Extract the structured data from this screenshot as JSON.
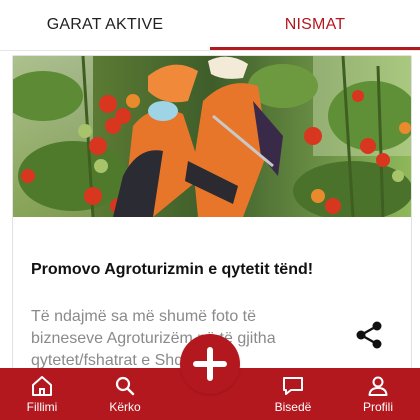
{
  "tabs": [
    {
      "label": "GARAT AKTIVE",
      "active": false
    },
    {
      "label": "NISMAT",
      "active": true
    }
  ],
  "card": {
    "image_icon": "greenhouse-tomato-workers-photo",
    "title": "Promovo Agroturizmin e qytetit tënd!",
    "body_lines": [
      "Të ndajmë sa më shumë foto të",
      "bizneseve Agroturizëm në të gjitha",
      "qytetet/fshatrat e Shq"
    ],
    "share_icon": "share-icon"
  },
  "bottom_nav": {
    "items": [
      {
        "label": "Fillimi",
        "icon": "home-icon"
      },
      {
        "label": "Kërko",
        "icon": "search-icon"
      },
      {
        "label": "Bisedë",
        "icon": "chat-icon"
      },
      {
        "label": "Profili",
        "icon": "user-icon"
      }
    ],
    "fab_icon": "plus-icon"
  },
  "colors": {
    "accent": "#b3181f",
    "text": "#111111",
    "muted": "#8a8a8a"
  }
}
